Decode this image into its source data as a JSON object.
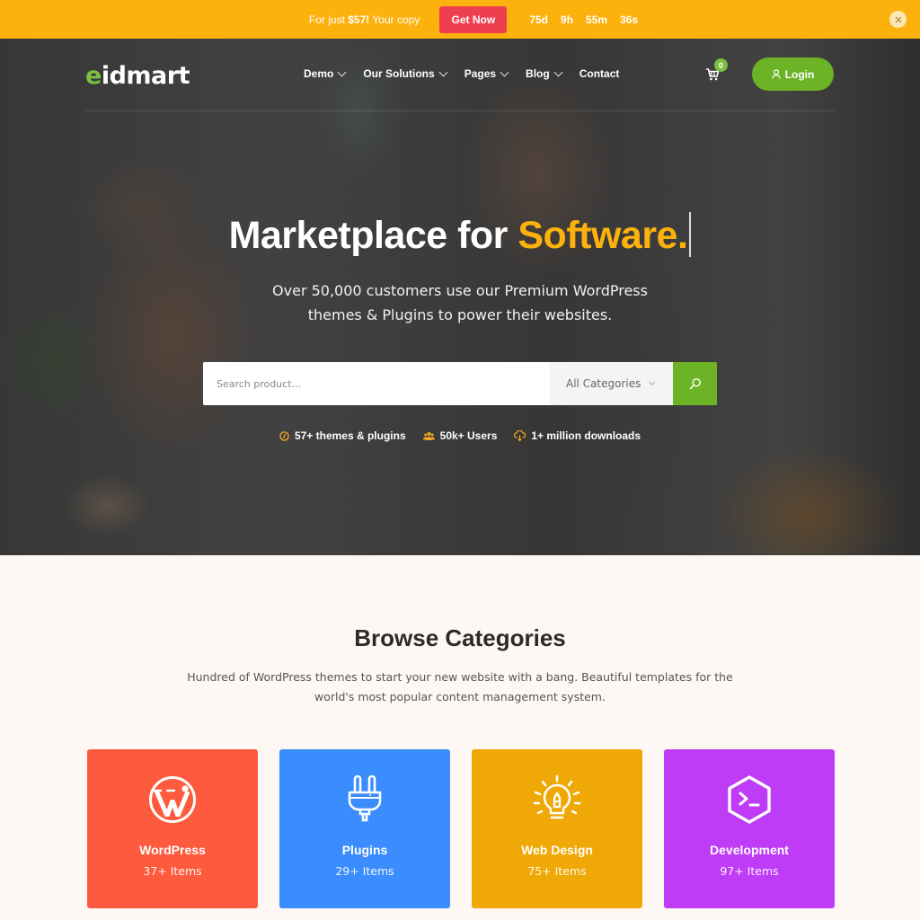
{
  "promo": {
    "text_prefix": "For just ",
    "price": "$57!",
    "text_suffix": " Your copy",
    "button_label": "Get Now",
    "countdown": [
      "75d",
      "9h",
      "55m",
      "36s"
    ],
    "close_icon": "close-icon"
  },
  "header": {
    "logo_first": "e",
    "logo_rest": "idmart",
    "nav": [
      {
        "label": "Demo",
        "has_dropdown": true
      },
      {
        "label": "Our Solutions",
        "has_dropdown": true
      },
      {
        "label": "Pages",
        "has_dropdown": true
      },
      {
        "label": "Blog",
        "has_dropdown": true
      },
      {
        "label": "Contact",
        "has_dropdown": false
      }
    ],
    "cart_count": "0",
    "login_label": "Login"
  },
  "hero": {
    "title_main": "Marketplace for ",
    "title_accent": "Software.",
    "subtitle_line1": "Over 50,000 customers use our Premium WordPress",
    "subtitle_line2": "themes & Plugins to power their websites.",
    "search": {
      "placeholder": "Search product...",
      "value": "",
      "category_selected": "All Categories"
    },
    "stats": [
      {
        "icon": "badge-icon",
        "label": "57+ themes & plugins"
      },
      {
        "icon": "users-icon",
        "label": "50k+ Users"
      },
      {
        "icon": "cloud-download-icon",
        "label": "1+ million downloads"
      }
    ]
  },
  "categories": {
    "title": "Browse Categories",
    "description_line1": "Hundred of WordPress themes to start your new website with a bang. Beautiful templates for the",
    "description_line2": "world's most popular content management system.",
    "items": [
      {
        "name": "WordPress",
        "count": "37+ Items",
        "icon": "wordpress-icon",
        "color": "#fe5a3d"
      },
      {
        "name": "Plugins",
        "count": "29+ Items",
        "icon": "plug-icon",
        "color": "#3b8dfd"
      },
      {
        "name": "Web Design",
        "count": "75+ Items",
        "icon": "lightbulb-pen-icon",
        "color": "#efa805"
      },
      {
        "name": "Development",
        "count": "97+ Items",
        "icon": "terminal-hexagon-icon",
        "color": "#bf3cf6"
      }
    ]
  }
}
